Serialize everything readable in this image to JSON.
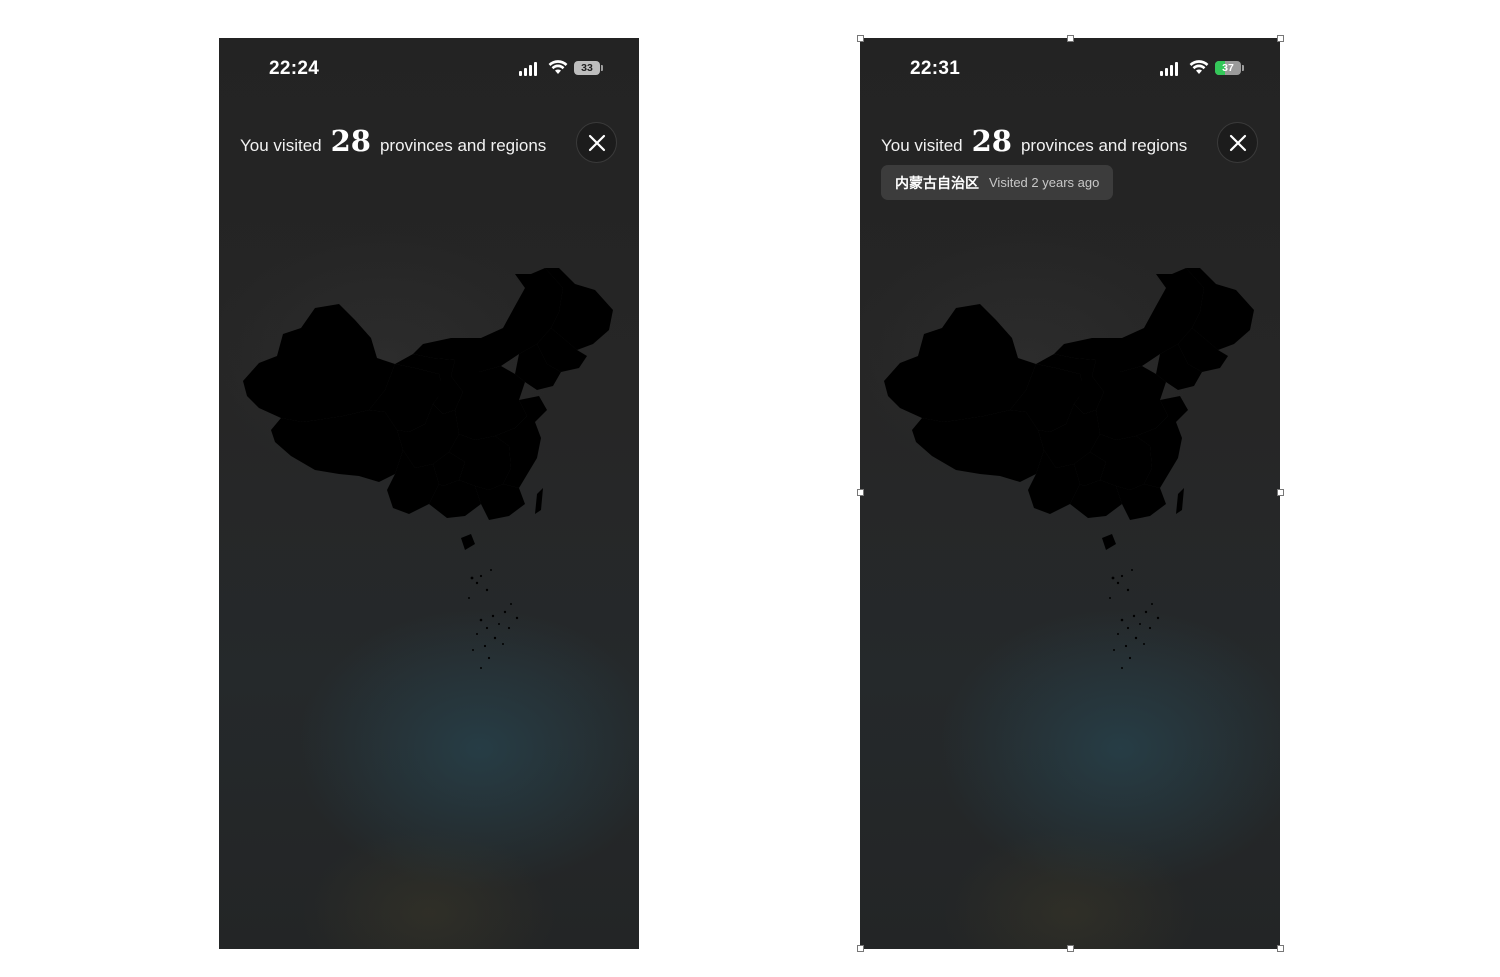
{
  "screens": [
    {
      "status": {
        "time": "22:24",
        "battery": "33"
      },
      "headline": {
        "prefix": "You visited",
        "count": "28",
        "suffix": "provinces and regions"
      }
    },
    {
      "status": {
        "time": "22:31",
        "battery": "37"
      },
      "headline": {
        "prefix": "You visited",
        "count": "28",
        "suffix": "provinces and regions"
      },
      "tooltip": {
        "region": "内蒙古自治区",
        "visited": "Visited 2 years ago"
      }
    }
  ],
  "colors": {
    "visited_region": "#2c7a3e",
    "highlighted_region": "#2fa84f",
    "unvisited_region": "#4b4b4d",
    "border": "#44c463",
    "background": "#242424"
  },
  "icons": [
    "signal-icon",
    "wifi-icon",
    "battery-icon",
    "close-icon"
  ]
}
